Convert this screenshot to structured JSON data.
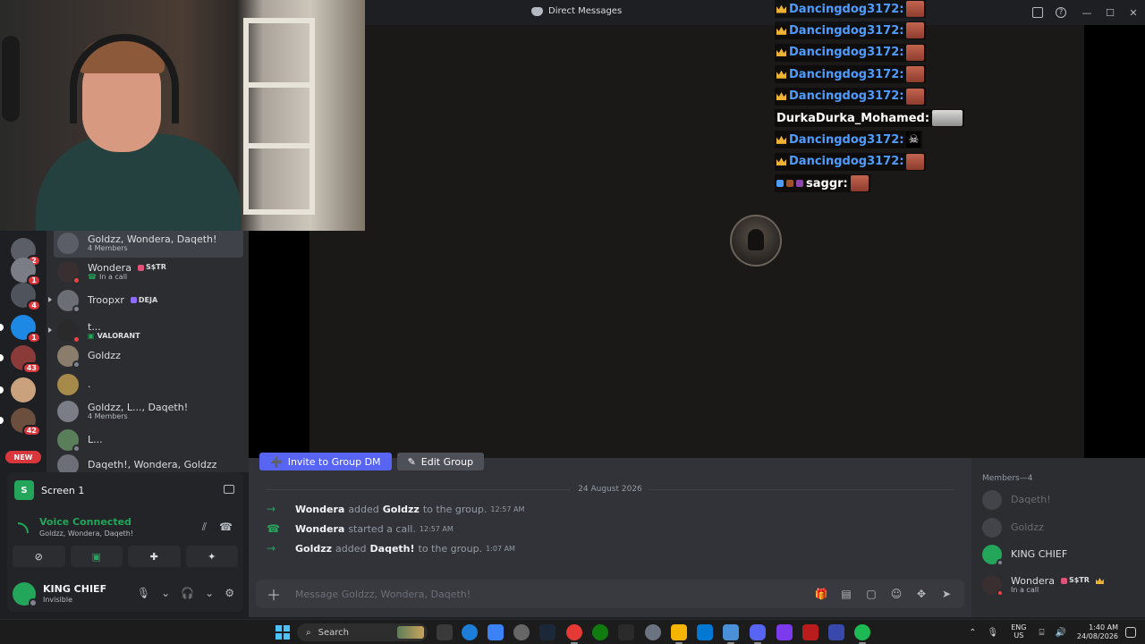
{
  "window": {
    "title": "Direct Messages"
  },
  "stream_chat": [
    {
      "user": "Dancingdog3172:",
      "badge": "crown",
      "emote": "emote"
    },
    {
      "user": "Dancingdog3172:",
      "badge": "crown",
      "emote": "emote"
    },
    {
      "user": "Dancingdog3172:",
      "badge": "crown",
      "emote": "emote"
    },
    {
      "user": "Dancingdog3172:",
      "badge": "crown",
      "emote": "emote"
    },
    {
      "user": "Dancingdog3172:",
      "badge": "crown",
      "emote": "emote"
    },
    {
      "user": "DurkaDurka_Mohamed:",
      "badge": "none",
      "emote": "photo"
    },
    {
      "user": "Dancingdog3172:",
      "badge": "crown",
      "emote": "skull"
    },
    {
      "user": "Dancingdog3172:",
      "badge": "crown",
      "emote": "emote"
    },
    {
      "user": "saggr:",
      "badge": "multi",
      "emote": "emote"
    }
  ],
  "server_rail": {
    "badges": [
      "2",
      "1",
      "4",
      "1",
      "43",
      "42"
    ],
    "new_label": "NEW"
  },
  "dm_list": [
    {
      "name": "Goldzz, Wondera, Daqeth!",
      "sub": "4 Members",
      "active": true
    },
    {
      "name": "Wondera",
      "tag": "S$TR",
      "sub": "In a call",
      "status": "red"
    },
    {
      "name": "Troopxr",
      "tag": "DEJA",
      "sub": "",
      "status": "grey"
    },
    {
      "name": "t...",
      "tag": "",
      "sub": "VALORANT",
      "status": "red"
    },
    {
      "name": "Goldzz",
      "tag": "",
      "sub": "",
      "status": "grey"
    },
    {
      "name": ".",
      "tag": "",
      "sub": "",
      "status": "none"
    },
    {
      "name": "Goldzz, L..., Daqeth!",
      "tag": "",
      "sub": "4 Members",
      "status": "none"
    },
    {
      "name": "L...",
      "tag": "",
      "sub": "",
      "status": "grey"
    },
    {
      "name": "Daqeth!, Wondera, Goldzz",
      "tag": "",
      "sub": "",
      "status": "none"
    }
  ],
  "screen_share": {
    "icon_letter": "S",
    "label": "Screen 1"
  },
  "voice": {
    "title": "Voice Connected",
    "channel": "Goldzz, Wondera, Daqeth!"
  },
  "user": {
    "name": "KING CHIEF",
    "status": "Invisible"
  },
  "chat_area": {
    "invite_label": "Invite to Group DM",
    "edit_label": "Edit Group",
    "date": "24 August 2026",
    "messages": [
      {
        "icon": "arrow",
        "actor": "Wondera",
        "verb": "added",
        "target": "Goldzz",
        "rest": "to the group.",
        "time": "12:57 AM"
      },
      {
        "icon": "phone",
        "actor": "Wondera",
        "verb": "started a call.",
        "target": "",
        "rest": "",
        "time": "12:57 AM"
      },
      {
        "icon": "arrow",
        "actor": "Goldzz",
        "verb": "added",
        "target": "Daqeth!",
        "rest": "to the group.",
        "time": "1:07 AM"
      }
    ],
    "composer_placeholder": "Message Goldzz, Wondera, Daqeth!"
  },
  "members": {
    "header": "Members—4",
    "list": [
      {
        "name": "Daqeth!",
        "sub": "",
        "dim": true,
        "tag": ""
      },
      {
        "name": "Goldzz",
        "sub": "",
        "dim": true,
        "tag": ""
      },
      {
        "name": "KING CHIEF",
        "sub": "",
        "dim": false,
        "tag": ""
      },
      {
        "name": "Wondera",
        "sub": "In a call",
        "dim": false,
        "tag": "S$TR"
      }
    ]
  },
  "taskbar": {
    "search_label": "Search",
    "lang_top": "ENG",
    "lang_bottom": "US",
    "time": "1:40 AM",
    "date": "24/08/2026",
    "discord_badge": "20"
  },
  "colors": {
    "discord_blurple": "#5865f2",
    "online_green": "#23a55a",
    "dnd_red": "#f23f43",
    "twitch_name_blue": "#4f9cff",
    "crown_gold": "#f0b232"
  }
}
